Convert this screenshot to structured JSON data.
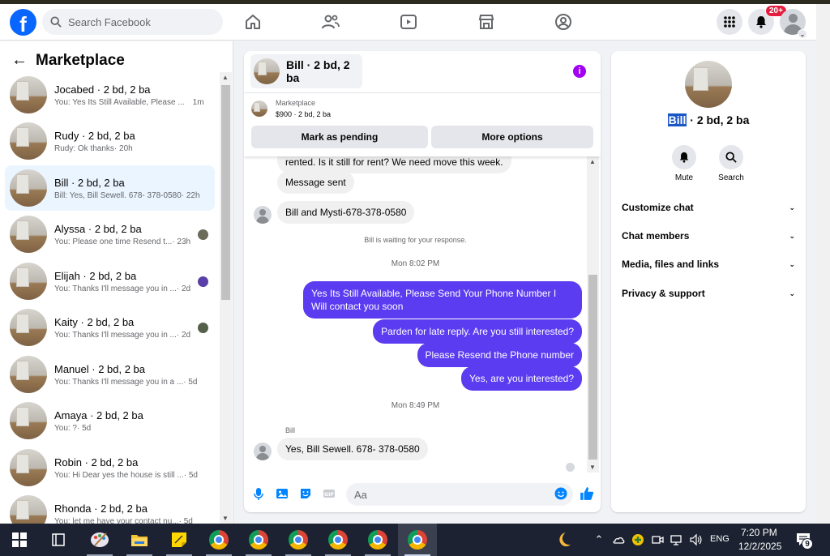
{
  "topbar": {
    "logo": "f",
    "search_placeholder": "Search Facebook",
    "notifications_badge": "20+"
  },
  "left": {
    "title": "Marketplace",
    "conversations": [
      {
        "name": "Jocabed · 2 bd, 2 ba",
        "preview": "You: Yes Its Still Available, Please ...",
        "time": "1m"
      },
      {
        "name": "Rudy · 2 bd, 2 ba",
        "preview": "Rudy: Ok thanks",
        "time": "· 20h"
      },
      {
        "name": "Bill · 2 bd, 2 ba",
        "preview": "Bill: Yes, Bill Sewell. 678- 378-0580",
        "time": "· 22h"
      },
      {
        "name": "Alyssa · 2 bd, 2 ba",
        "preview": "You: Please one time Resend t...",
        "time": "· 23h"
      },
      {
        "name": "Elijah · 2 bd, 2 ba",
        "preview": "You: Thanks I'll message you in ...",
        "time": "· 2d"
      },
      {
        "name": "Kaity · 2 bd, 2 ba",
        "preview": "You: Thanks I'll message you in ...",
        "time": "· 2d"
      },
      {
        "name": "Manuel · 2 bd, 2 ba",
        "preview": "You: Thanks I'll message you in a ...",
        "time": "· 5d"
      },
      {
        "name": "Amaya · 2 bd, 2 ba",
        "preview": "You: ?",
        "time": "· 5d"
      },
      {
        "name": "Robin · 2 bd, 2 ba",
        "preview": "You: Hi Dear yes the house is still ...",
        "time": "· 5d"
      },
      {
        "name": "Rhonda · 2 bd, 2 ba",
        "preview": "You: let me have your contact nu...",
        "time": "· 5d"
      }
    ]
  },
  "chat": {
    "header_name": "Bill · 2 bd, 2 ba",
    "listing_category": "Marketplace",
    "listing_info": "$900 · 2 bd, 2 ba",
    "mark_pending": "Mark as pending",
    "more_options": "More options",
    "msg_partial": "rented.  Is it still for rent?  We need move this week.",
    "msg_sent": "Message sent",
    "msg_phone": "Bill and Mysti-678-378-0580",
    "waiting_note": "Bill is waiting for your response.",
    "time1": "Mon 8:02 PM",
    "out1": "Yes Its Still Available, Please Send Your Phone Number I Will contact you soon",
    "out2": "Parden for late reply. Are you still interested?",
    "out3": "Please Resend the Phone number",
    "out4": "Yes, are you interested?",
    "time2": "Mon 8:49 PM",
    "sender_label": "Bill",
    "in_last": "Yes, Bill Sewell.  678- 378-0580",
    "composer_placeholder": "Aa"
  },
  "right": {
    "title_highlight": "Bill",
    "title_rest": " · 2 bd, 2 ba",
    "mute": "Mute",
    "search": "Search",
    "rows": [
      "Customize chat",
      "Chat members",
      "Media, files and links",
      "Privacy & support"
    ]
  },
  "taskbar": {
    "time": "7:20 PM",
    "date": "12/2/2025",
    "lang": "ENG",
    "notif_count": "9"
  },
  "colors": {
    "brand": "#0866ff",
    "outgoing_bubble": "#5b3cf0",
    "info": "#a100f2"
  }
}
